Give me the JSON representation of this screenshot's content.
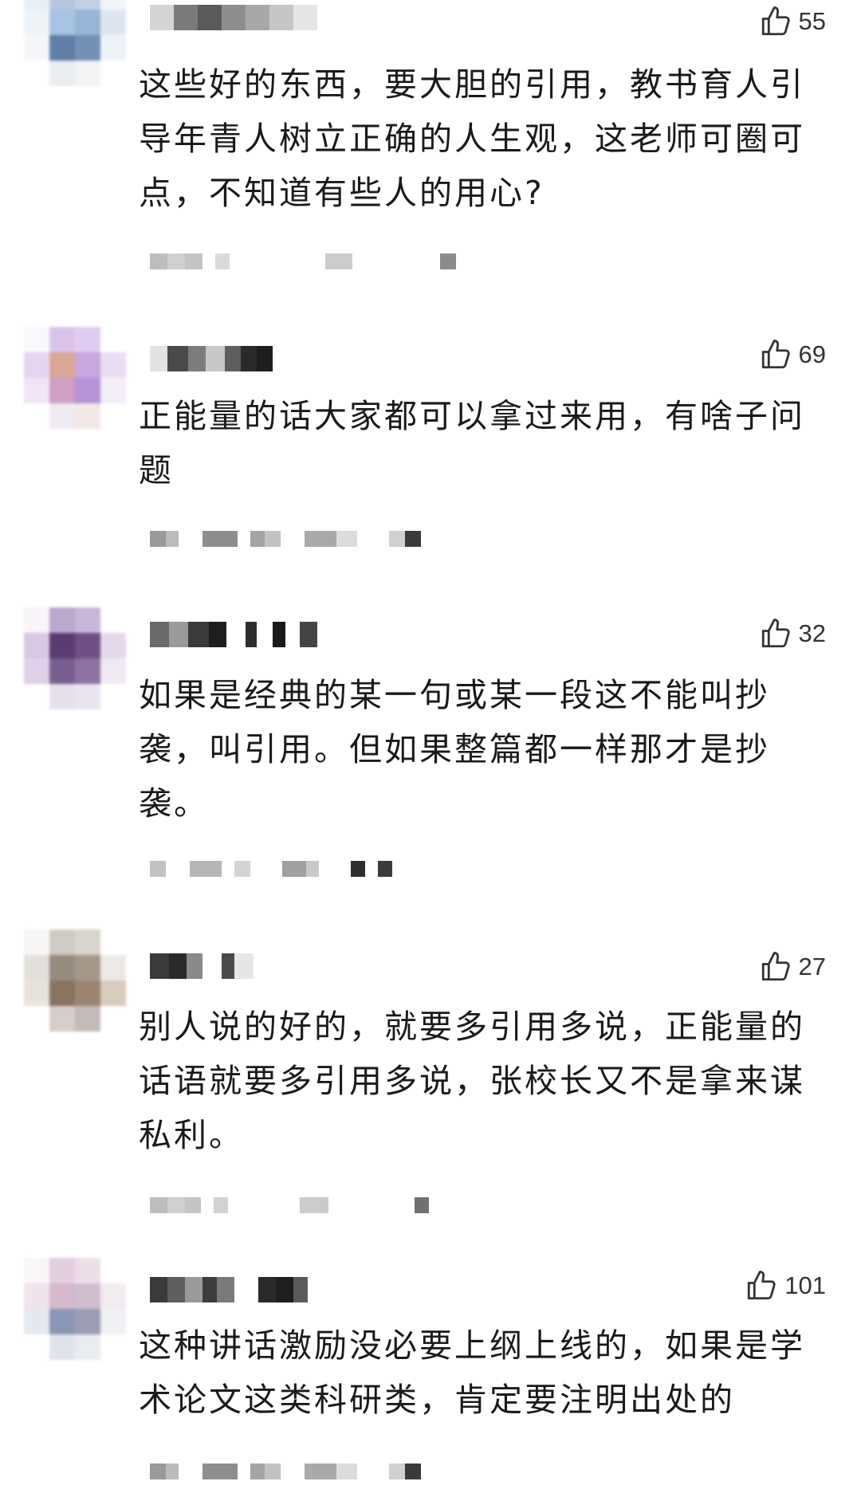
{
  "comments": [
    {
      "likes": "55",
      "text": "这些好的东西，要大胆的引用，教书育人引导年青人树立正确的人生观，这老师可圈可点，不知道有些人的用心?"
    },
    {
      "likes": "69",
      "text": "正能量的话大家都可以拿过来用，有啥子问题"
    },
    {
      "likes": "32",
      "text": "如果是经典的某一句或某一段这不能叫抄袭，叫引用。但如果整篇都一样那才是抄袭。"
    },
    {
      "likes": "27",
      "text": "别人说的好的，就要多引用多说，正能量的话语就要多引用多说，张校长又不是拿来谋私利。"
    },
    {
      "likes": "101",
      "text": "这种讲话激励没必要上纲上线的，如果是学术论文这类科研类，肯定要注明出处的"
    }
  ],
  "icons": {
    "like": "thumbs-up-icon"
  }
}
